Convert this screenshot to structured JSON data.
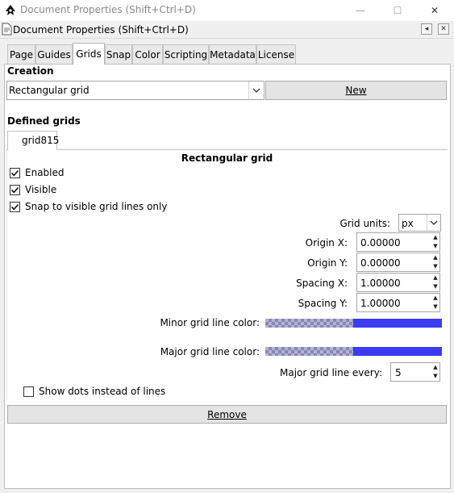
{
  "window": {
    "title": "Document Properties (Shift+Ctrl+D)",
    "controls": {
      "minimize": "—",
      "maximize": "☐",
      "close": "✕"
    }
  },
  "dock": {
    "title": "Document Properties (Shift+Ctrl+D)",
    "buttons": [
      "◂",
      "✕"
    ]
  },
  "tabs": [
    {
      "label": "Page"
    },
    {
      "label": "Guides"
    },
    {
      "label": "Grids",
      "active": true
    },
    {
      "label": "Snap"
    },
    {
      "label": "Color"
    },
    {
      "label": "Scripting"
    },
    {
      "label": "Metadata"
    },
    {
      "label": "License"
    }
  ],
  "creation": {
    "heading": "Creation",
    "grid_type": "Rectangular grid",
    "new_button": "New"
  },
  "defined_grids": {
    "heading": "Defined grids",
    "tab_label": "grid815"
  },
  "grid": {
    "title": "Rectangular grid",
    "enabled": {
      "label": "Enabled",
      "checked": true
    },
    "visible": {
      "label": "Visible",
      "checked": true
    },
    "snap_visible": {
      "label": "Snap to visible grid lines only",
      "checked": true
    },
    "units_label": "Grid units:",
    "units_value": "px",
    "origin_x_label": "Origin X:",
    "origin_x": "0.00000",
    "origin_y_label": "Origin Y:",
    "origin_y": "0.00000",
    "spacing_x_label": "Spacing X:",
    "spacing_x": "1.00000",
    "spacing_y_label": "Spacing Y:",
    "spacing_y": "1.00000",
    "minor_color_label": "Minor grid line color:",
    "major_color_label": "Major grid line color:",
    "line_color": "#3b3bf2",
    "major_every_label": "Major grid line every:",
    "major_every": "5",
    "show_dots": {
      "label": "Show dots instead of lines",
      "checked": false
    }
  },
  "remove_button": "Remove"
}
